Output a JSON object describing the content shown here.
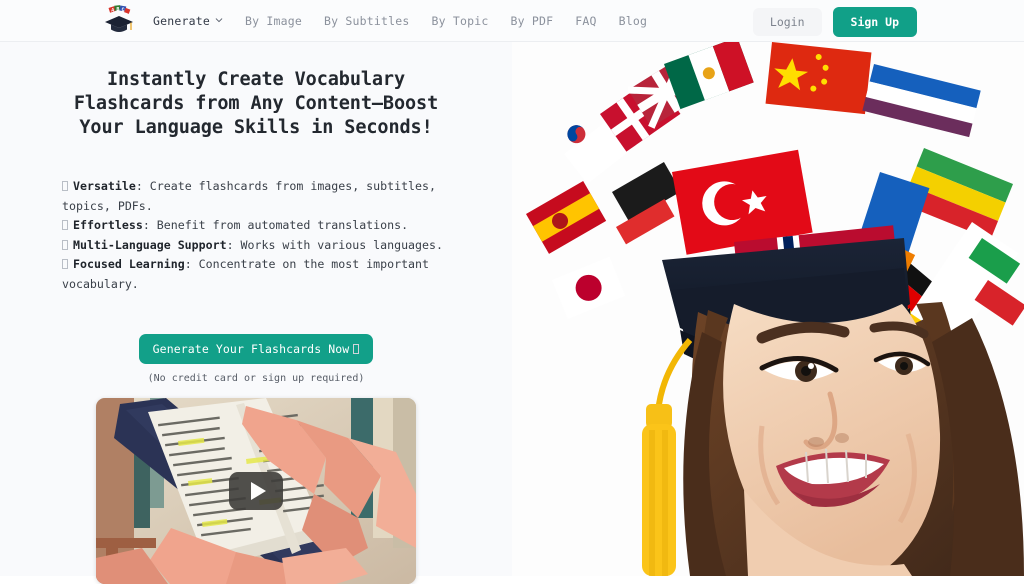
{
  "header": {
    "logo_icon": "graduation-cap-flags-logo",
    "nav": [
      {
        "label": "Generate",
        "active": true,
        "has_dropdown": true,
        "icon": "chevron-down-icon"
      },
      {
        "label": "By Image",
        "active": false,
        "has_dropdown": false
      },
      {
        "label": "By Subtitles",
        "active": false,
        "has_dropdown": false
      },
      {
        "label": "By Topic",
        "active": false,
        "has_dropdown": false
      },
      {
        "label": "By PDF",
        "active": false,
        "has_dropdown": false
      },
      {
        "label": "FAQ",
        "active": false,
        "has_dropdown": false
      },
      {
        "label": "Blog",
        "active": false,
        "has_dropdown": false
      }
    ],
    "login_label": "Login",
    "signup_label": "Sign Up",
    "accent_color": "#12a089",
    "login_bg": "#f4f5f7",
    "background": "#fbfcfd"
  },
  "hero": {
    "headline": "Instantly Create Vocabulary Flashcards from Any Content—Boost Your Language Skills in Seconds!",
    "bullets": [
      {
        "marker": "missing-glyph-box",
        "term": "Versatile",
        "separator": ": ",
        "text": "Create flashcards from images, subtitles, topics, PDFs."
      },
      {
        "marker": "missing-glyph-box",
        "term": "Effortless",
        "separator": ": ",
        "text": "Benefit from automated translations."
      },
      {
        "marker": "missing-glyph-box",
        "term": "Multi-Language Support",
        "separator": ": ",
        "text": "Works with various languages."
      },
      {
        "marker": "missing-glyph-box",
        "term": "Focused Learning",
        "separator": ": ",
        "text": "Concentrate on the most important vocabulary."
      }
    ],
    "cta_label": "Generate Your Flashcards Now",
    "cta_trailing_icon": "missing-glyph-box",
    "cta_note": "(No credit card or sign up required)",
    "background": "#f9fafc",
    "image_alt": "smiling-woman-graduation-cap-with-world-flags"
  },
  "video": {
    "icon": "play-button-icon",
    "thumbnail_alt": "hands-holding-tablet-with-highlighted-text"
  }
}
